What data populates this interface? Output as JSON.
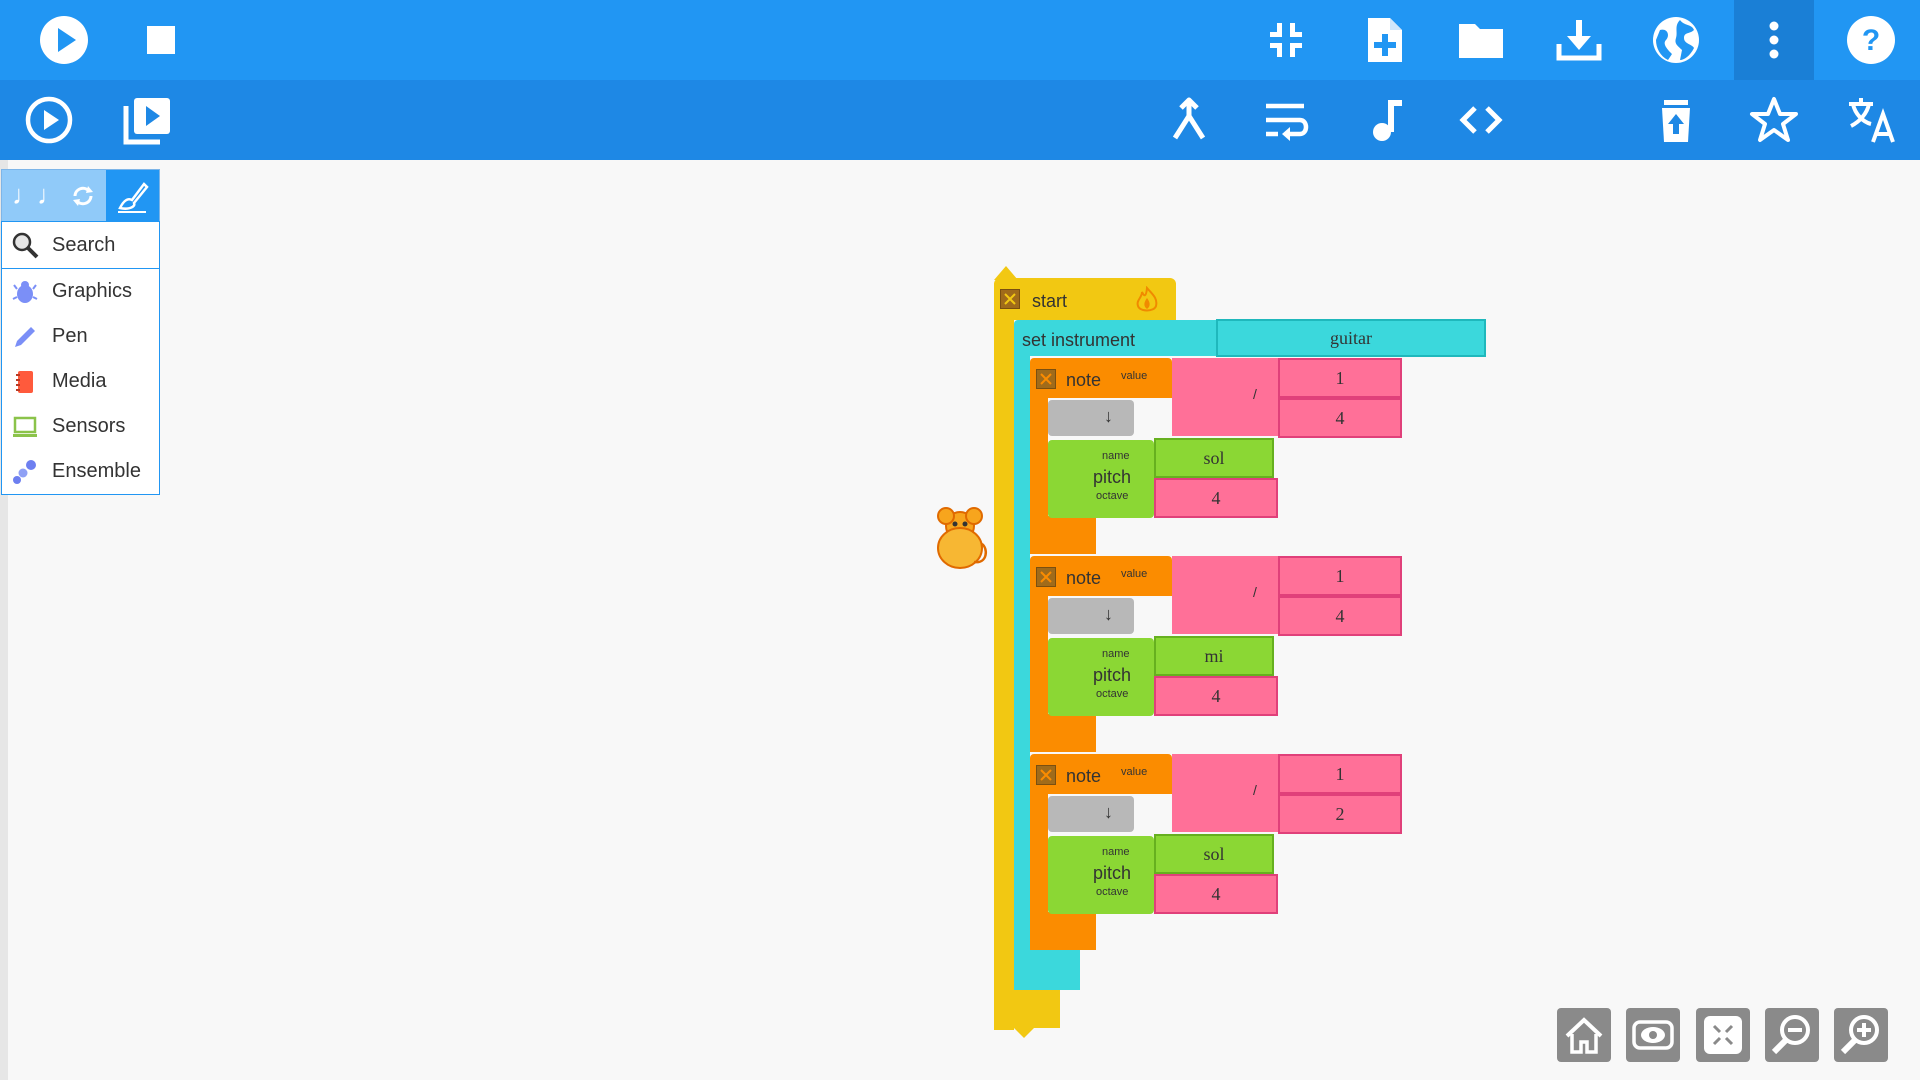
{
  "palette": {
    "search_label": "Search",
    "items": [
      {
        "label": "Graphics",
        "icon": "graphics-icon",
        "color": "#7b8ff7"
      },
      {
        "label": "Pen",
        "icon": "pen-icon",
        "color": "#7b8ff7"
      },
      {
        "label": "Media",
        "icon": "media-icon",
        "color": "#ff5a3c"
      },
      {
        "label": "Sensors",
        "icon": "sensors-icon",
        "color": "#8bc34a"
      },
      {
        "label": "Ensemble",
        "icon": "ensemble-icon",
        "color": "#6d7ff0"
      }
    ]
  },
  "program": {
    "start_label": "start",
    "instrument_label": "set instrument",
    "instrument_value": "guitar",
    "notes": [
      {
        "label": "note",
        "value_label": "value",
        "numerator": "1",
        "divide": "/",
        "denominator": "4",
        "arrow": "↓",
        "pitch_label": "pitch",
        "name_label": "name",
        "octave_label": "octave",
        "name": "sol",
        "octave": "4"
      },
      {
        "label": "note",
        "value_label": "value",
        "numerator": "1",
        "divide": "/",
        "denominator": "4",
        "arrow": "↓",
        "pitch_label": "pitch",
        "name_label": "name",
        "octave_label": "octave",
        "name": "mi",
        "octave": "4"
      },
      {
        "label": "note",
        "value_label": "value",
        "numerator": "1",
        "divide": "/",
        "denominator": "2",
        "arrow": "↓",
        "pitch_label": "pitch",
        "name_label": "name",
        "octave_label": "octave",
        "name": "sol",
        "octave": "4"
      }
    ]
  },
  "colors": {
    "toolbar": "#2196f3",
    "toolbar_secondary": "#1e88e5",
    "start_block": "#f2c812",
    "instrument_block": "#3bd8dc",
    "note_block": "#fb8c00",
    "pitch_block": "#8bd734",
    "number_block": "#ff7098"
  }
}
